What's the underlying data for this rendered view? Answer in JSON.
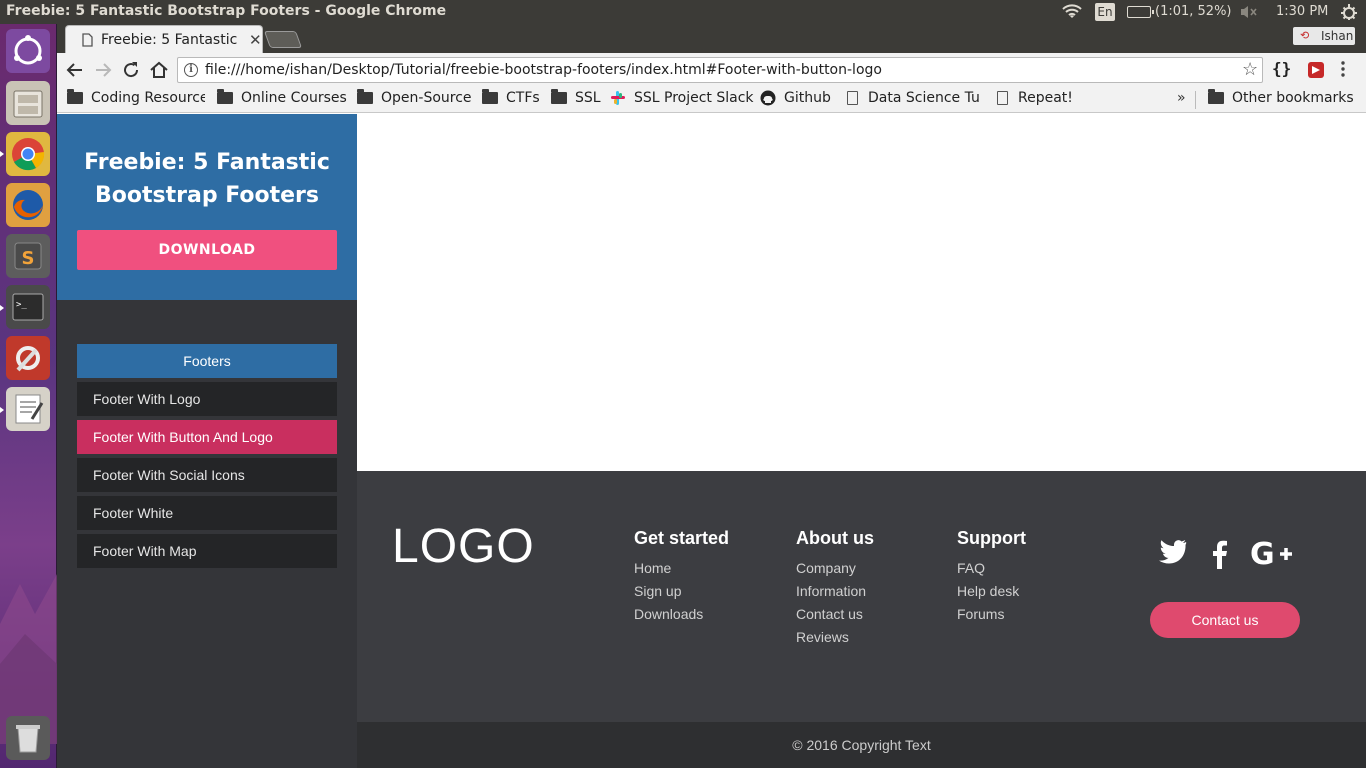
{
  "os_panel": {
    "window_title": "Freebie: 5 Fantastic Bootstrap Footers - Google Chrome",
    "language": "En",
    "battery": "(1:01, 52%)",
    "clock": "1:30 PM"
  },
  "launcher": {
    "items": [
      "ubuntu-dash",
      "files",
      "chrome",
      "firefox",
      "sublime-text",
      "terminal",
      "system-settings",
      "text-editor",
      "trash"
    ]
  },
  "browser": {
    "tab_title": "Freebie: 5 Fantastic",
    "profile_name": "Ishan",
    "url": "file:///home/ishan/Desktop/Tutorial/freebie-bootstrap-footers/index.html#Footer-with-button-logo",
    "ext_brackets": "{}",
    "bookmarks": [
      {
        "label": "Coding Resource",
        "icon": "folder-icon"
      },
      {
        "label": "Online Courses",
        "icon": "folder-icon"
      },
      {
        "label": "Open-Source",
        "icon": "folder-icon"
      },
      {
        "label": "CTFs",
        "icon": "folder-icon"
      },
      {
        "label": "SSL",
        "icon": "folder-icon"
      },
      {
        "label": "SSL Project Slack",
        "icon": "slack-icon"
      },
      {
        "label": "Github",
        "icon": "github-icon"
      },
      {
        "label": "Data Science Tut",
        "icon": "page-icon"
      },
      {
        "label": "Repeat!",
        "icon": "page-icon"
      }
    ],
    "bookmarks_overflow": "»",
    "other_bookmarks": "Other bookmarks"
  },
  "sidebar": {
    "title": "Freebie: 5 Fantastic Bootstrap Footers",
    "download_label": "DOWNLOAD",
    "section_label": "Footers",
    "items": [
      {
        "label": "Footer With Logo",
        "active": false
      },
      {
        "label": "Footer With Button And Logo",
        "active": true
      },
      {
        "label": "Footer With Social Icons",
        "active": false
      },
      {
        "label": "Footer White",
        "active": false
      },
      {
        "label": "Footer With Map",
        "active": false
      }
    ]
  },
  "footer": {
    "logo": "LOGO",
    "columns": [
      {
        "heading": "Get started",
        "links": [
          "Home",
          "Sign up",
          "Downloads"
        ]
      },
      {
        "heading": "About us",
        "links": [
          "Company",
          "Information",
          "Contact us",
          "Reviews"
        ]
      },
      {
        "heading": "Support",
        "links": [
          "FAQ",
          "Help desk",
          "Forums"
        ]
      }
    ],
    "social": [
      "twitter-icon",
      "facebook-icon",
      "google-plus-icon"
    ],
    "contact_label": "Contact us",
    "copyright": "© 2016 Copyright Text"
  },
  "colors": {
    "sidebar_blue": "#2e6da4",
    "download_pink": "#f0507f",
    "active_item": "#c92f5f",
    "footer_bg": "#3c3d41",
    "contact_btn": "#df4a6e"
  }
}
